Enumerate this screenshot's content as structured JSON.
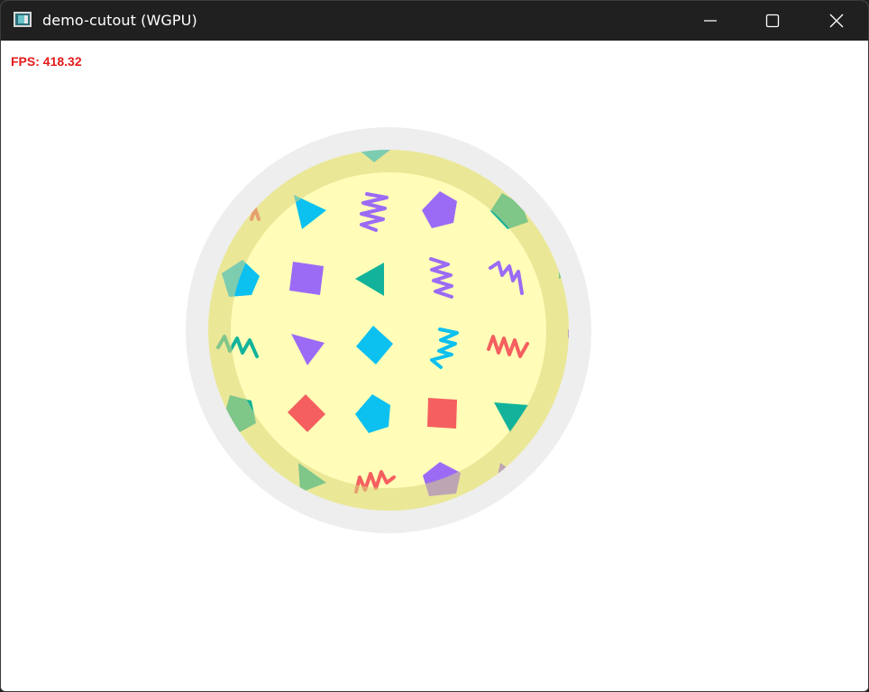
{
  "window": {
    "title": "demo-cutout (WGPU)",
    "icon": "app-window-icon",
    "controls": [
      "minimize-icon",
      "maximize-icon",
      "close-icon"
    ]
  },
  "overlay": {
    "fps_text": "FPS: 418.32"
  },
  "colors": {
    "titlebar": "#202020",
    "fps": "#e31b1b",
    "outer_ring": "#eeeeee",
    "inner_ring": "#e8e5a6",
    "disc": "#fffdb8",
    "purple": "#9b6bf5",
    "cyan": "#0cc0f0",
    "teal": "#12b39a",
    "red": "#f55f5f"
  }
}
